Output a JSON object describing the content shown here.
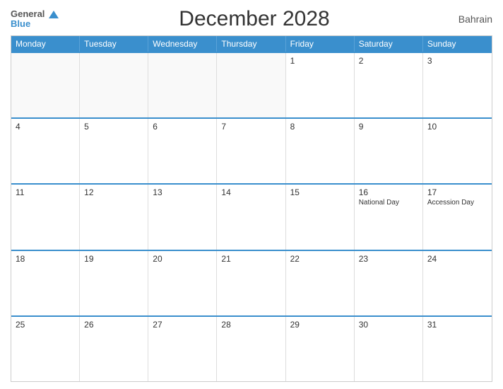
{
  "header": {
    "logo_general": "General",
    "logo_blue": "Blue",
    "title": "December 2028",
    "country": "Bahrain"
  },
  "days": [
    "Monday",
    "Tuesday",
    "Wednesday",
    "Thursday",
    "Friday",
    "Saturday",
    "Sunday"
  ],
  "weeks": [
    [
      {
        "num": "",
        "empty": true
      },
      {
        "num": "",
        "empty": true
      },
      {
        "num": "",
        "empty": true
      },
      {
        "num": "",
        "empty": true
      },
      {
        "num": "1"
      },
      {
        "num": "2"
      },
      {
        "num": "3"
      }
    ],
    [
      {
        "num": "4"
      },
      {
        "num": "5"
      },
      {
        "num": "6"
      },
      {
        "num": "7"
      },
      {
        "num": "8"
      },
      {
        "num": "9"
      },
      {
        "num": "10"
      }
    ],
    [
      {
        "num": "11"
      },
      {
        "num": "12"
      },
      {
        "num": "13"
      },
      {
        "num": "14"
      },
      {
        "num": "15"
      },
      {
        "num": "16",
        "event": "National Day"
      },
      {
        "num": "17",
        "event": "Accession Day"
      }
    ],
    [
      {
        "num": "18"
      },
      {
        "num": "19"
      },
      {
        "num": "20"
      },
      {
        "num": "21"
      },
      {
        "num": "22"
      },
      {
        "num": "23"
      },
      {
        "num": "24"
      }
    ],
    [
      {
        "num": "25"
      },
      {
        "num": "26"
      },
      {
        "num": "27"
      },
      {
        "num": "28"
      },
      {
        "num": "29"
      },
      {
        "num": "30"
      },
      {
        "num": "31"
      }
    ]
  ]
}
